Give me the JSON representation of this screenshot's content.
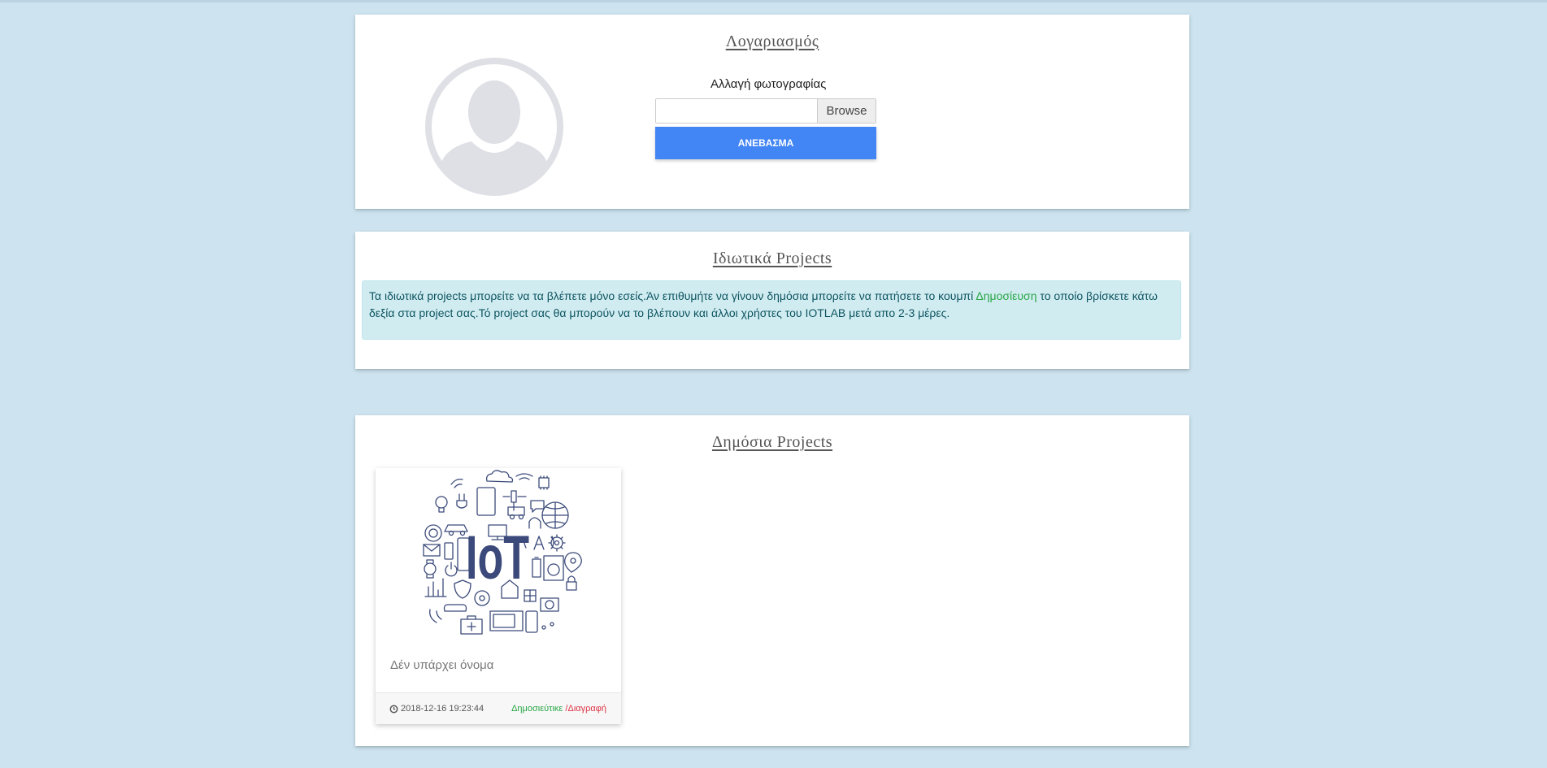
{
  "account": {
    "title": "Λογαριασμός",
    "change_photo_label": "Αλλαγή φωτογραφίας",
    "file_input_value": "",
    "browse_label": "Browse",
    "upload_label": "ΑΝΕΒΑΣΜΑ"
  },
  "private_projects": {
    "title": "Ιδιωτικά Projects",
    "info_before": "Τα ιδιωτικά projects μπορείτε να τα βλέπετε μόνο εσείς.Άν επιθυμήτε να γίνουν δημόσια μπορείτε να πατήσετε το κουμπί ",
    "info_highlight": "Δημοσίευση",
    "info_after": " το οποίο βρίσκετε κάτω δεξία στα project σας.Τό project σας θα μπορούν να το βλέπουν και άλλοι χρήστες του IOTLAB μετά απο 2-3 μέρες."
  },
  "public_projects": {
    "title": "Δημόσια Projects",
    "cards": [
      {
        "image_text": "IoT",
        "name": "Δέν υπάρχει όνομα",
        "date": "2018-12-16 19:23:44",
        "status_published": "Δημοσιεύτικε",
        "status_separator": " /",
        "status_delete": "Διαγραφή"
      }
    ]
  },
  "colors": {
    "background": "#cde4f0",
    "upload_button": "#4285f4",
    "info_bg": "#d1ecf1",
    "published": "#28a745",
    "delete": "#dc3545",
    "iot_navy": "#3b4a7a"
  },
  "icons": [
    "avatar-placeholder-icon",
    "clock-icon"
  ]
}
